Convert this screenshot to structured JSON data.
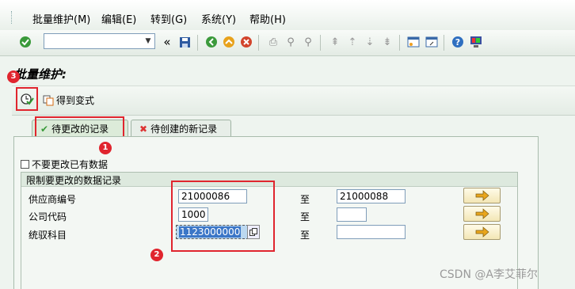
{
  "menu": [
    "批量维护(M)",
    "编辑(E)",
    "转到(G)",
    "系统(Y)",
    "帮助(H)"
  ],
  "toolbar": {
    "command_value": "",
    "nav_symbol": "«",
    "icons": [
      "enter-icon",
      "save-icon",
      "back-icon",
      "exit-icon",
      "cancel-icon",
      "print-icon",
      "find-icon",
      "find-next-icon",
      "first-page-icon",
      "prev-page-icon",
      "next-page-icon",
      "last-page-icon",
      "create-session-icon",
      "shortcut-icon",
      "help-icon",
      "layout-icon"
    ]
  },
  "title": "批量维护:",
  "app_toolbar": {
    "variant_label": "得到变式"
  },
  "tabs": [
    {
      "label": "待更改的记录",
      "icon": "check-icon"
    },
    {
      "label": "待创建的新记录",
      "icon": "cross-icon"
    }
  ],
  "checkbox": {
    "label": "不要更改已有数据",
    "checked": false
  },
  "group": {
    "title": "限制要更改的数据记录",
    "to_label": "至",
    "rows": [
      {
        "label": "供应商编号",
        "from": "21000086",
        "to": "21000088"
      },
      {
        "label": "公司代码",
        "from": "1000",
        "to": ""
      },
      {
        "label": "统驭科目",
        "from": "1123000000",
        "to": ""
      }
    ]
  },
  "annotations": [
    "1",
    "2",
    "3"
  ],
  "watermark": "CSDN @A李艾菲尔",
  "colors": {
    "accent_red": "#e0252e",
    "panel_bg": "#f3f7f3",
    "tab_active": "#dcebd9"
  }
}
